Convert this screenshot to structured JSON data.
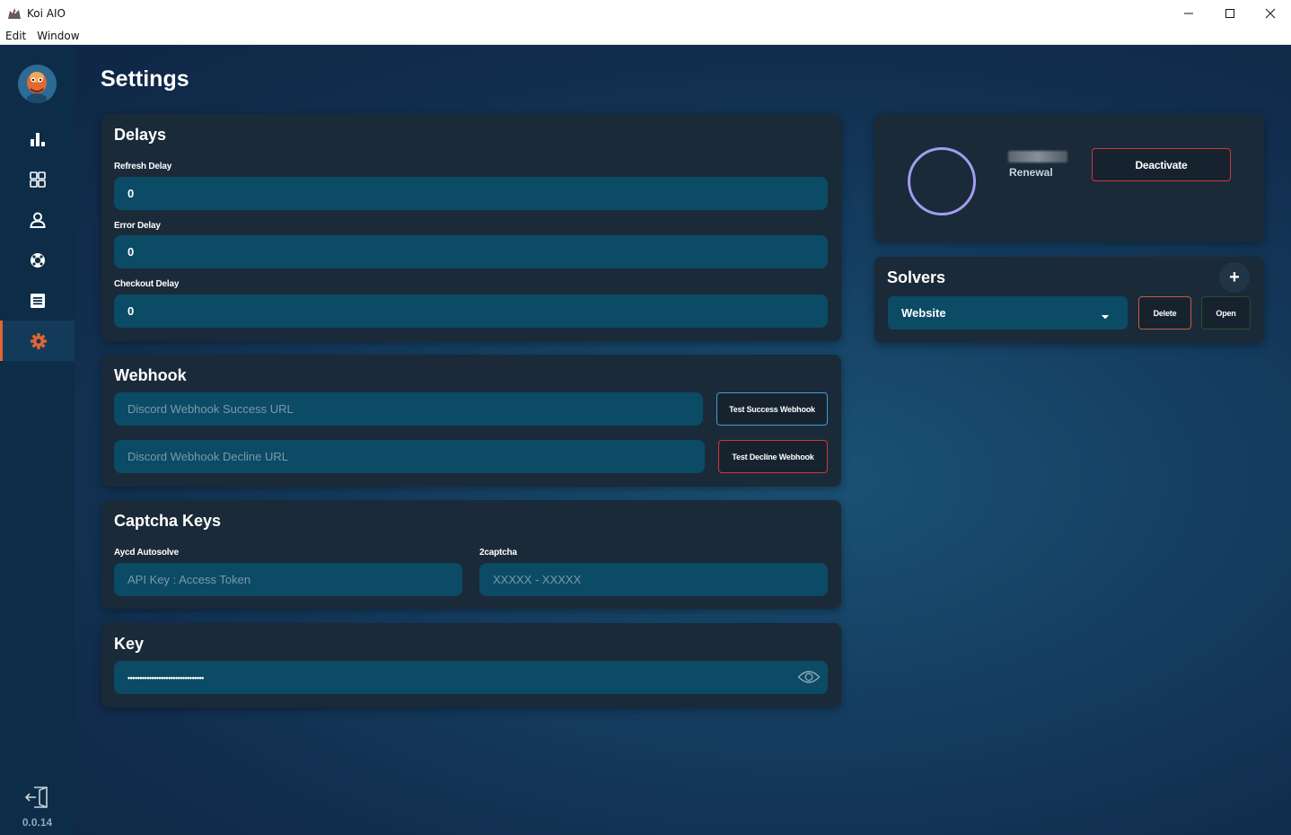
{
  "window": {
    "title": "Koi AIO"
  },
  "menu": {
    "items": [
      "Edit",
      "Window"
    ]
  },
  "sidebar": {
    "version": "0.0.14"
  },
  "page": {
    "title": "Settings"
  },
  "delays": {
    "title": "Delays",
    "refresh_label": "Refresh Delay",
    "refresh_value": "0",
    "error_label": "Error Delay",
    "error_value": "0",
    "checkout_label": "Checkout Delay",
    "checkout_value": "0"
  },
  "webhook": {
    "title": "Webhook",
    "success_placeholder": "Discord Webhook Success URL",
    "decline_placeholder": "Discord Webhook Decline URL",
    "test_success_label": "Test Success Webhook",
    "test_decline_label": "Test Decline Webhook"
  },
  "captcha": {
    "title": "Captcha Keys",
    "aycd_label": "Aycd Autosolve",
    "aycd_placeholder": "API Key : Access Token",
    "twocaptcha_label": "2captcha",
    "twocaptcha_placeholder": "XXXXX - XXXXX"
  },
  "key": {
    "title": "Key",
    "value": "••••••••••••••••••••••••••••••••"
  },
  "license": {
    "renewal_label": "Renewal",
    "deactivate_label": "Deactivate"
  },
  "solvers": {
    "title": "Solvers",
    "add_label": "+",
    "selected": "Website",
    "delete_label": "Delete",
    "open_label": "Open"
  },
  "colors": {
    "accent": "#e1652f",
    "input_bg": "#0b4b66",
    "card_bg": "#1a2a38",
    "ring": "#a49cf0"
  }
}
